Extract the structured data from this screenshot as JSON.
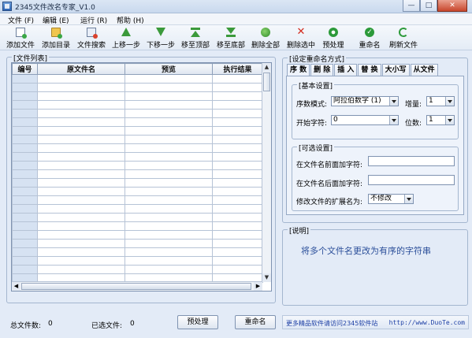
{
  "window": {
    "title": "2345文件改名专家_V1.0",
    "controls": {
      "minimize": "—",
      "maximize": "□",
      "close": "✕"
    }
  },
  "menu": [
    "文件 (F)",
    "编辑 (E)",
    "运行 (R)",
    "帮助 (H)"
  ],
  "toolbar": [
    {
      "label": "添加文件",
      "icon": "add-file-icon"
    },
    {
      "label": "添加目录",
      "icon": "add-folder-icon"
    },
    {
      "label": "文件搜索",
      "icon": "file-search-icon"
    },
    {
      "label": "上移一步",
      "icon": "arrow-up-icon"
    },
    {
      "label": "下移一步",
      "icon": "arrow-down-icon"
    },
    {
      "label": "移至顶部",
      "icon": "move-top-icon"
    },
    {
      "label": "移至底部",
      "icon": "move-bottom-icon"
    },
    {
      "label": "删除全部",
      "icon": "delete-all-icon"
    },
    {
      "label": "删除选中",
      "icon": "delete-selected-icon"
    },
    {
      "label": "预处理",
      "icon": "preview-icon"
    },
    {
      "label": "重命名",
      "icon": "rename-icon"
    },
    {
      "label": "刷新文件",
      "icon": "refresh-icon"
    }
  ],
  "file_list": {
    "title": "[文件列表]",
    "columns": [
      "编号",
      "原文件名",
      "预览",
      "执行结果"
    ],
    "rows": []
  },
  "rename_panel": {
    "title": "[设定重命名方式]",
    "tabs": [
      "序 数",
      "删 除",
      "插 入",
      "替 换",
      "大小写",
      "从文件"
    ],
    "basic": {
      "title": "[基本设置]",
      "mode_label": "序数模式:",
      "mode_value": "阿拉伯数字 (1)",
      "increment_label": "增量:",
      "increment_value": "1",
      "start_label": "开始字符:",
      "start_value": "0",
      "digits_label": "位数:",
      "digits_value": "1"
    },
    "optional": {
      "title": "[可选设置]",
      "prefix_label": "在文件名前面加字符:",
      "prefix_value": "",
      "suffix_label": "在文件名后面加字符:",
      "suffix_value": "",
      "ext_label": "修改文件的扩展名为:",
      "ext_value": "不修改"
    }
  },
  "description": {
    "title": "[说明]",
    "text": "将多个文件名更改为有序的字符串"
  },
  "status": {
    "total_label": "总文件数:",
    "total_value": "0",
    "selected_label": "已选文件:",
    "selected_value": "0"
  },
  "buttons": {
    "preview": "预处理",
    "rename": "重命名"
  },
  "ad": {
    "text": "更多精品软件请访问2345软件站",
    "url": "http://www.DuoTe.com"
  }
}
